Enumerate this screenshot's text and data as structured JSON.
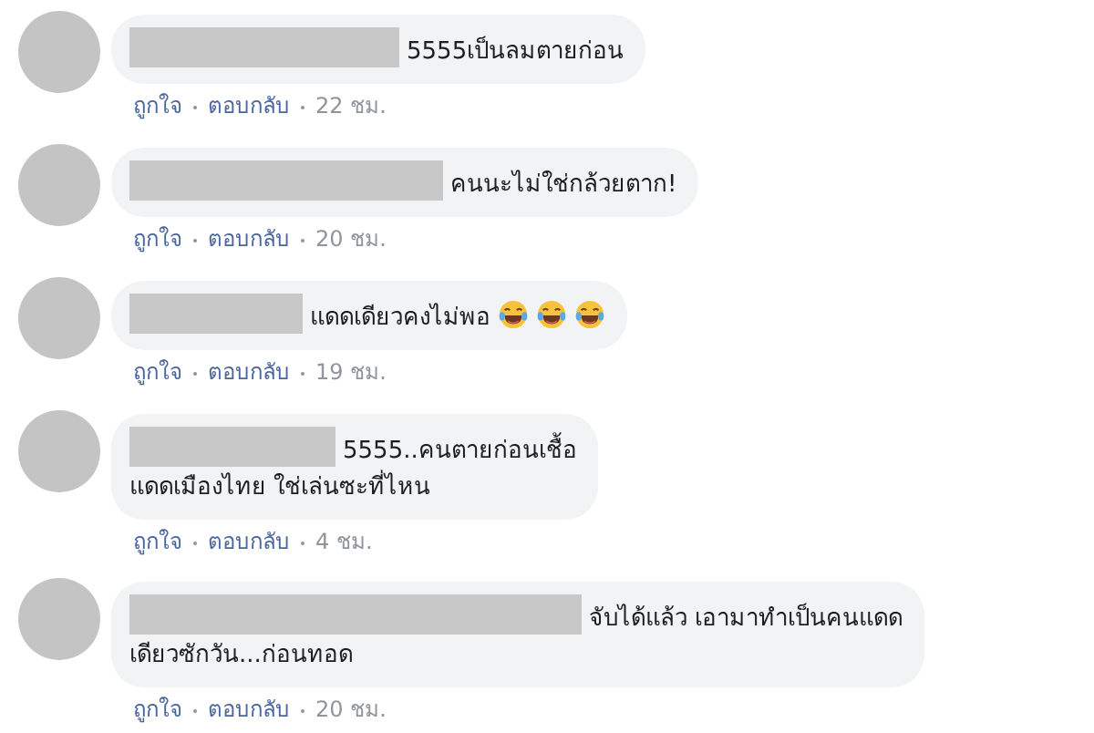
{
  "comments": [
    {
      "author_redacted": true,
      "text_lines": [
        "5555เป็นลมตายก่อน"
      ],
      "actions": [
        "ถูกใจ",
        "ตอบกลับ"
      ],
      "time": "22 ชม."
    },
    {
      "author_redacted": true,
      "text_lines": [
        "คนนะไม่ใช่กล้วยตาก!"
      ],
      "actions": [
        "ถูกใจ",
        "ตอบกลับ"
      ],
      "time": "20 ชม."
    },
    {
      "author_redacted": true,
      "text_lines": [
        "แดดเดียวคงไม่พอ"
      ],
      "emojis": [
        {
          "kind": "tears-of-joy"
        },
        {
          "kind": "tears-of-joy"
        },
        {
          "kind": "tears-of-joy"
        }
      ],
      "actions": [
        "ถูกใจ",
        "ตอบกลับ"
      ],
      "time": "19 ชม."
    },
    {
      "author_redacted": true,
      "text_lines": [
        "5555..คนตายก่อนเชื้อ",
        "แดดเมืองไทย ใช่เล่นซะที่ไหน"
      ],
      "actions": [
        "ถูกใจ",
        "ตอบกลับ"
      ],
      "time": "4 ชม."
    },
    {
      "author_redacted": true,
      "text_lines": [
        "จับได้แล้ว เอามาทำเป็นคนแดด",
        "เดียวซักวัน...ก่อนทอด"
      ],
      "actions": [
        "ถูกใจ",
        "ตอบกลับ"
      ],
      "time": "20 ชม."
    }
  ]
}
